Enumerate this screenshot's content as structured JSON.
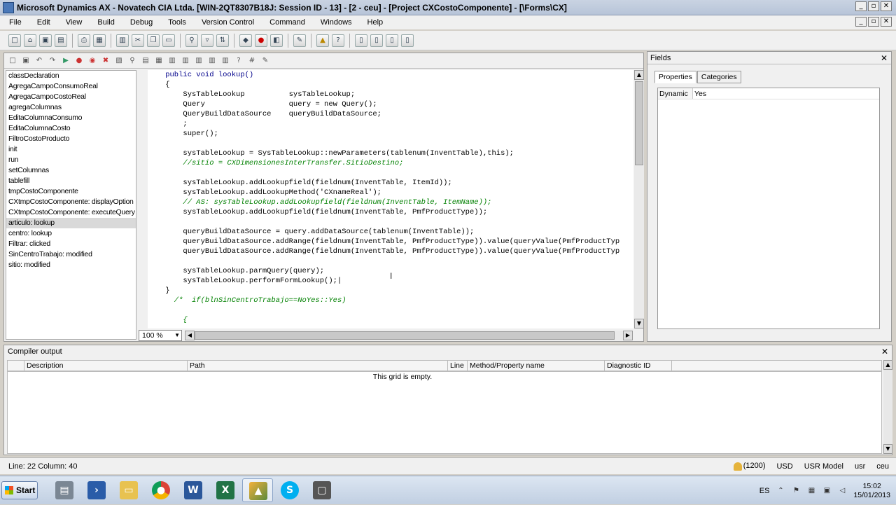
{
  "window": {
    "title": "Microsoft Dynamics AX - Novatech CIA Ltda. [WIN-2QT8307B18J: Session ID - 13] -  [2 - ceu] - [Project CXCostoComponente] - [\\Forms\\CX]"
  },
  "menu": [
    "File",
    "Edit",
    "View",
    "Build",
    "Debug",
    "Tools",
    "Version Control",
    "Command",
    "Windows",
    "Help"
  ],
  "methods": [
    "classDeclaration",
    "AgregaCampoConsumoReal",
    "AgregaCampoCostoReal",
    "agregaColumnas",
    "EditaColumnaConsumo",
    "EditaColumnaCosto",
    "FiltroCostoProducto",
    "init",
    "run",
    "setColumnas",
    "tablefill",
    "tmpCostoComponente",
    "CXtmpCostoComponente: displayOption",
    "CXtmpCostoComponente: executeQuery",
    "articulo: lookup",
    "centro: lookup",
    "Filtrar: clicked",
    "SinCentroTrabajo: modified",
    "sitio: modified"
  ],
  "selected_method": "articulo: lookup",
  "code_lines": [
    {
      "cls": "kw",
      "text": "    public void lookup()"
    },
    {
      "cls": "",
      "text": "    {"
    },
    {
      "cls": "",
      "text": "        SysTableLookup          sysTableLookup;"
    },
    {
      "cls": "",
      "text": "        Query                   query = new Query();"
    },
    {
      "cls": "",
      "text": "        QueryBuildDataSource    queryBuildDataSource;"
    },
    {
      "cls": "",
      "text": "        ;"
    },
    {
      "cls": "",
      "text": "        super();"
    },
    {
      "cls": "",
      "text": ""
    },
    {
      "cls": "",
      "text": "        sysTableLookup = SysTableLookup::newParameters(tablenum(InventTable),this);"
    },
    {
      "cls": "cm",
      "text": "        //sitio = CXDimensionesInterTransfer.SitioDestino;"
    },
    {
      "cls": "",
      "text": ""
    },
    {
      "cls": "",
      "text": "        sysTableLookup.addLookupfield(fieldnum(InventTable, ItemId));"
    },
    {
      "cls": "",
      "text": "        sysTableLookup.addLookupMethod('CXnameReal');"
    },
    {
      "cls": "cm",
      "text": "        // AS: sysTableLookup.addLookupfield(fieldnum(InventTable, ItemName));"
    },
    {
      "cls": "",
      "text": "        sysTableLookup.addLookupfield(fieldnum(InventTable, PmfProductType));"
    },
    {
      "cls": "",
      "text": ""
    },
    {
      "cls": "",
      "text": "        queryBuildDataSource = query.addDataSource(tablenum(InventTable));"
    },
    {
      "cls": "",
      "text": "        queryBuildDataSource.addRange(fieldnum(InventTable, PmfProductType)).value(queryValue(PmfProductTyp"
    },
    {
      "cls": "",
      "text": "        queryBuildDataSource.addRange(fieldnum(InventTable, PmfProductType)).value(queryValue(PmfProductTyp"
    },
    {
      "cls": "",
      "text": ""
    },
    {
      "cls": "",
      "text": "        sysTableLookup.parmQuery(query);"
    },
    {
      "cls": "",
      "text": "        sysTableLookup.performFormLookup();|"
    },
    {
      "cls": "",
      "text": "    }"
    },
    {
      "cls": "cm",
      "text": "      /*  if(blnSinCentroTrabajo==NoYes::Yes)"
    },
    {
      "cls": "",
      "text": ""
    },
    {
      "cls": "cm",
      "text": "        {"
    }
  ],
  "zoom": "100 %",
  "fields_panel": {
    "title": "Fields",
    "tabs": [
      "Properties",
      "Categories"
    ],
    "property_name": "Dynamic",
    "property_value": "Yes"
  },
  "compiler": {
    "title": "Compiler output",
    "columns": [
      "Description",
      "Path",
      "Line",
      "Method/Property name",
      "Diagnostic ID"
    ],
    "empty_text": "This grid is empty."
  },
  "status": {
    "position": "Line: 22 Column: 40",
    "notifications": "(1200)",
    "currency": "USD",
    "model": "USR Model",
    "layer": "usr",
    "company": "ceu"
  },
  "taskbar": {
    "start": "Start",
    "language": "ES",
    "time": "15:02",
    "date": "15/01/2013"
  }
}
